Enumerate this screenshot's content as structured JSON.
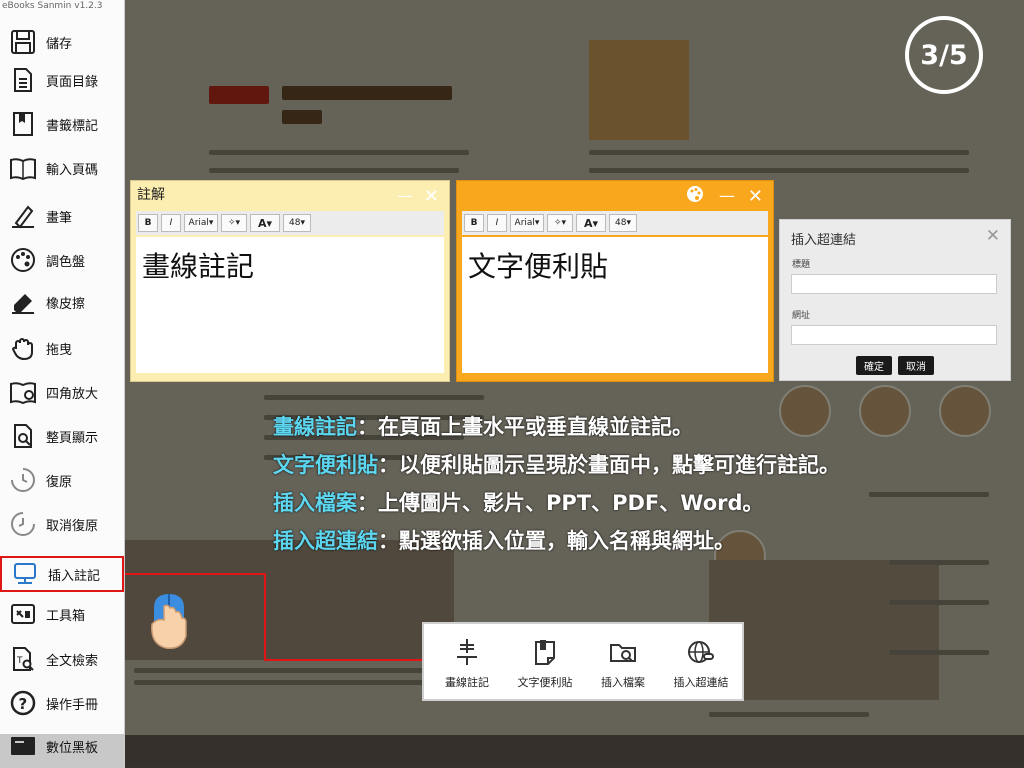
{
  "app": {
    "version": "eBooks Sanmin v1.2.3"
  },
  "sidebar": {
    "items": [
      {
        "label": "儲存",
        "icon": "save-icon"
      },
      {
        "label": "頁面目錄",
        "icon": "page-toc-icon"
      },
      {
        "label": "書籤標記",
        "icon": "bookmark-icon"
      },
      {
        "label": "輸入頁碼",
        "icon": "page-number-icon"
      },
      {
        "label": "畫筆",
        "icon": "pen-icon"
      },
      {
        "label": "調色盤",
        "icon": "palette-icon"
      },
      {
        "label": "橡皮擦",
        "icon": "eraser-icon"
      },
      {
        "label": "拖曳",
        "icon": "hand-icon"
      },
      {
        "label": "四角放大",
        "icon": "corner-zoom-icon"
      },
      {
        "label": "整頁顯示",
        "icon": "fit-page-icon"
      },
      {
        "label": "復原",
        "icon": "undo-icon"
      },
      {
        "label": "取消復原",
        "icon": "redo-icon"
      },
      {
        "label": "插入註記",
        "icon": "insert-annotation-icon"
      },
      {
        "label": "工具箱",
        "icon": "toolbox-icon"
      },
      {
        "label": "全文檢索",
        "icon": "fulltext-search-icon"
      },
      {
        "label": "操作手冊",
        "icon": "help-icon"
      },
      {
        "label": "數位黑板",
        "icon": "blackboard-icon"
      }
    ],
    "active_item": "插入註記"
  },
  "step_indicator": "3/5",
  "note_annotation": {
    "title": "註解",
    "font": "Arial",
    "font_size": "48",
    "bold": "B",
    "italic": "I",
    "text_color": "A",
    "content": "畫線註記"
  },
  "sticky_note": {
    "font": "Arial",
    "font_size": "48",
    "bold": "B",
    "italic": "I",
    "text_color": "A",
    "content": "文字便利貼"
  },
  "hyperlink_dialog": {
    "title": "插入超連結",
    "title_label": "標題",
    "url_label": "網址",
    "title_value": "",
    "url_value": "",
    "confirm": "確定",
    "cancel": "取消"
  },
  "caption": {
    "lines": [
      {
        "term": "畫線註記",
        "desc": "：在頁面上畫水平或垂直線並註記。"
      },
      {
        "term": "文字便利貼",
        "desc": "：以便利貼圖示呈現於畫面中，點擊可進行註記。"
      },
      {
        "term": "插入檔案",
        "desc": "：上傳圖片、影片、PPT、PDF、Word。"
      },
      {
        "term": "插入超連結",
        "desc": "：點選欲插入位置，輸入名稱與網址。"
      }
    ]
  },
  "annotation_menu": {
    "items": [
      {
        "label": "畫線註記",
        "icon": "line-annotation-icon"
      },
      {
        "label": "文字便利貼",
        "icon": "sticky-note-icon"
      },
      {
        "label": "插入檔案",
        "icon": "insert-file-icon"
      },
      {
        "label": "插入超連結",
        "icon": "insert-link-icon"
      }
    ]
  },
  "colors": {
    "highlight": "#e01616",
    "caption_term": "#5dd6f0",
    "note_bg": "#fbeeb0",
    "sticky_bg": "#f9a81e"
  }
}
